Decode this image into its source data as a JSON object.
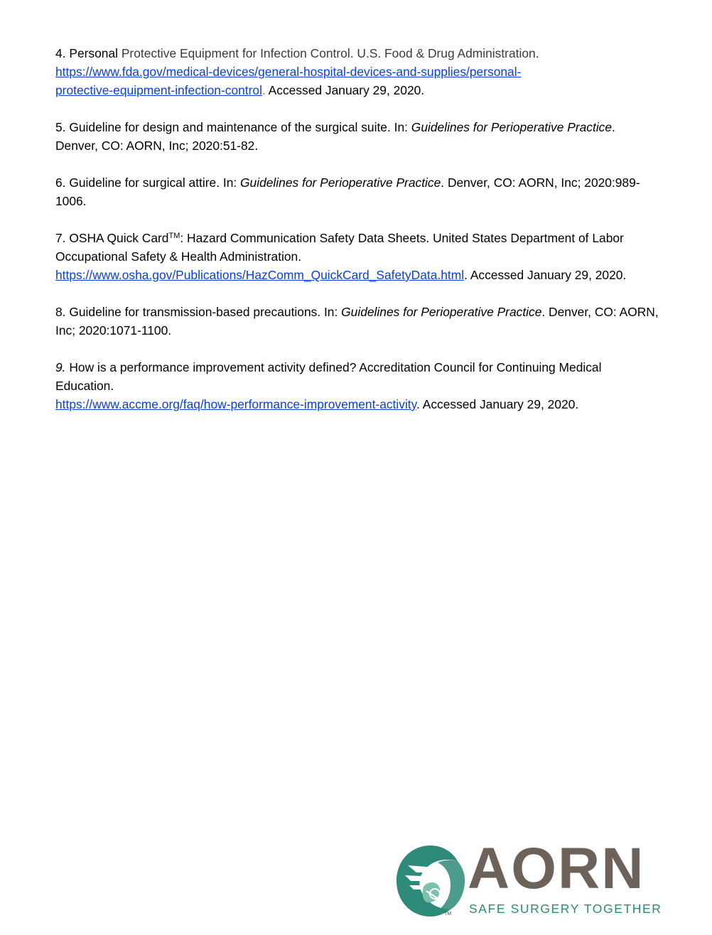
{
  "references": [
    {
      "number": "4.",
      "lead": "Personal",
      "title_rest": " Protective Equipment for Infection Control. U.S. Food & Drug Administration.",
      "url_line1": "https://www.fda.gov/medical-devices/general-hospital-devices-and-supplies/personal-",
      "url_line2": "protective-equipment-infection-control",
      "url_tail": ".",
      "accessed": " Accessed January 29, 2020."
    },
    {
      "number": "5.",
      "text": " Guideline for design and maintenance of the surgical suite. In: ",
      "italic": "Guidelines for Perioperative Practice",
      "after": ". Denver, CO: AORN, Inc; 2020:51-82."
    },
    {
      "number": "6.",
      "text": " Guideline for surgical attire. In: ",
      "italic": "Guidelines for Perioperative Practice",
      "after": ". Denver, CO: AORN, Inc; 2020:989-1006."
    },
    {
      "number": "7.",
      "text_before_tm": " OSHA Quick Card",
      "tm": "TM",
      "text_after_tm": ": Hazard Communication Safety Data Sheets. United States Department of Labor Occupational Safety & Health Administration.",
      "url": "https://www.osha.gov/Publications/HazComm_QuickCard_SafetyData.html",
      "accessed": ". Accessed January 29, 2020."
    },
    {
      "number": "8.",
      "text": " Guideline for transmission-based precautions. In: ",
      "italic": "Guidelines for Perioperative Practice",
      "after": ". Denver, CO: AORN, Inc; 2020:1071-1100."
    },
    {
      "number": "9.",
      "text": " How is a performance improvement activity defined? Accreditation Council for Continuing Medical Education.",
      "url": "https://www.accme.org/faq/how-performance-improvement-activity",
      "accessed": ". Accessed January 29, 2020."
    }
  ],
  "logo": {
    "wordmark": "AORN",
    "tagline": "SAFE SURGERY TOGETHER",
    "trademark": "TM",
    "colors": {
      "wordmark": "#6d625a",
      "teal": "#2d8a78",
      "teal_light": "#7fbfad"
    }
  },
  "colors": {
    "link": "#0b3fd6",
    "text": "#000000"
  }
}
